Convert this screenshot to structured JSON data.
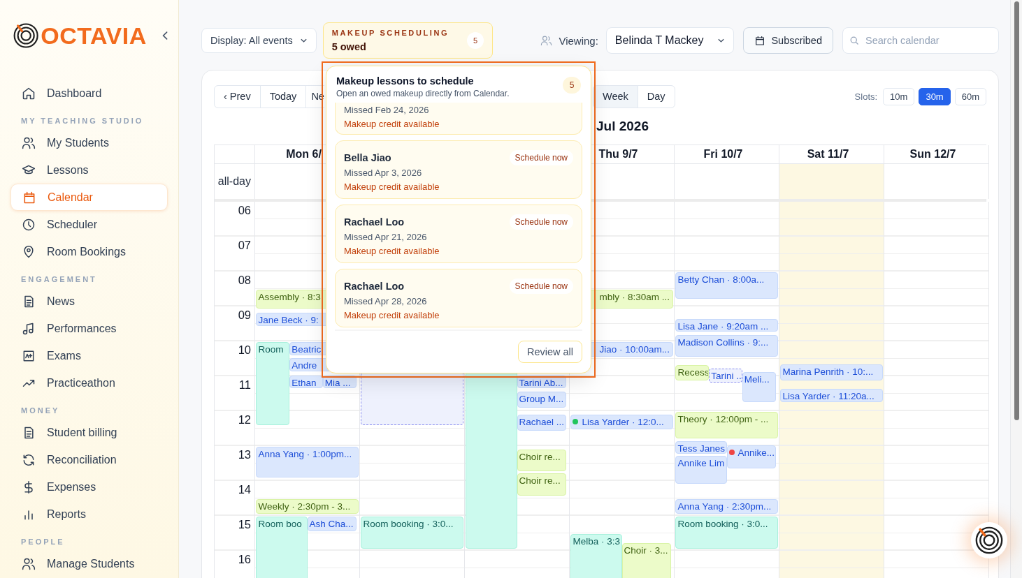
{
  "sidebar": {
    "brand": "OCTAVIA",
    "sections": [
      {
        "items": [
          {
            "label": "Dashboard",
            "selected": false
          }
        ]
      },
      {
        "heading": "MY TEACHING STUDIO",
        "items": [
          {
            "label": "My Students",
            "selected": false
          },
          {
            "label": "Lessons",
            "selected": false
          },
          {
            "label": "Calendar",
            "selected": true
          },
          {
            "label": "Scheduler",
            "selected": false
          },
          {
            "label": "Room Bookings",
            "selected": false
          }
        ]
      },
      {
        "heading": "ENGAGEMENT",
        "items": [
          {
            "label": "News",
            "selected": false
          },
          {
            "label": "Performances",
            "selected": false
          },
          {
            "label": "Exams",
            "selected": false
          },
          {
            "label": "Practiceathon",
            "selected": false
          }
        ]
      },
      {
        "heading": "MONEY",
        "items": [
          {
            "label": "Student billing",
            "selected": false
          },
          {
            "label": "Reconciliation",
            "selected": false
          },
          {
            "label": "Expenses",
            "selected": false
          },
          {
            "label": "Reports",
            "selected": false
          }
        ]
      },
      {
        "heading": "PEOPLE",
        "items": [
          {
            "label": "Manage Students",
            "selected": false
          }
        ]
      }
    ]
  },
  "toolbar": {
    "display_filter": "Display: All events",
    "makeup_summary": {
      "label": "MAKEUP SCHEDULING",
      "value": "5 owed",
      "count": "5"
    },
    "viewing_label": "Viewing:",
    "viewing_value": "Belinda T Mackey",
    "subscribe_button": "Subscribed",
    "search": {
      "placeholder": "Search calendar"
    }
  },
  "calendar": {
    "nav": [
      "‹ Prev",
      "Today",
      "Ne"
    ],
    "views": [
      {
        "label": "Week",
        "selected": true
      },
      {
        "label": "Day",
        "selected": false
      }
    ],
    "slots_label": "Slots:",
    "slots": [
      {
        "label": "10m",
        "selected": false
      },
      {
        "label": "30m",
        "selected": true
      },
      {
        "label": "60m",
        "selected": false
      }
    ],
    "title": "Jul 2026",
    "allday_label": "all-day",
    "hours": [
      "06",
      "07",
      "08",
      "09",
      "10",
      "11",
      "12",
      "13",
      "14",
      "15",
      "16"
    ],
    "days": [
      {
        "label": "Mon 6/",
        "highlighted": false,
        "events": [
          {
            "text": "Assembly · 8:3",
            "kind": "event"
          },
          {
            "text": "Jane Beck · 9:",
            "kind": "lesson"
          },
          {
            "text": "Room",
            "kind": "room"
          },
          {
            "text": "Beatric",
            "kind": "lesson"
          },
          {
            "text": "Andre",
            "kind": "lesson"
          },
          {
            "text": "Ethan",
            "kind": "lesson"
          },
          {
            "text": "Mia ...",
            "kind": "lesson"
          },
          {
            "text": "Anna Yang · 1:00pm...",
            "kind": "lesson"
          },
          {
            "text": "Weekly · 2:30pm - 3...",
            "kind": "event"
          },
          {
            "text": "Room boo",
            "kind": "room"
          },
          {
            "text": "Ash Cha...",
            "kind": "lesson"
          }
        ]
      },
      {
        "events": [
          {
            "kind": "pending"
          },
          {
            "text": "Room booking · 3:0...",
            "kind": "room"
          }
        ]
      },
      {
        "events": [
          {
            "kind": "room"
          },
          {
            "text": "Tarini Ab...",
            "kind": "lesson"
          },
          {
            "text": "Group M...",
            "kind": "lesson"
          },
          {
            "text": "Rachael ...",
            "kind": "lesson"
          },
          {
            "text": "Choir re...",
            "kind": "event"
          },
          {
            "text": "Choir re...",
            "kind": "event"
          }
        ]
      },
      {
        "label": "Thu 9/7",
        "highlighted": false,
        "events": [
          {
            "text": "mbly · 8:30am ...",
            "kind": "event"
          },
          {
            "text": "Jiao · 10:00am...",
            "kind": "lesson"
          },
          {
            "text": "Lisa Yarder · 12:0...",
            "kind": "lesson",
            "color": "#22c55e"
          },
          {
            "text": "Melba · 3:3",
            "kind": "room"
          },
          {
            "text": "Choir · 3...",
            "kind": "event"
          }
        ]
      },
      {
        "label": "Fri 10/7",
        "highlighted": false,
        "events": [
          {
            "text": "Betty Chan · 8:00a...",
            "kind": "lesson"
          },
          {
            "text": "Lisa Jane · 9:20am ...",
            "kind": "lesson"
          },
          {
            "text": "Madison Collins · 9:...",
            "kind": "lesson"
          },
          {
            "text": "Recess",
            "kind": "event"
          },
          {
            "text": "Tarini ..",
            "kind": "pending"
          },
          {
            "text": "Meli...",
            "kind": "lesson"
          },
          {
            "text": "Theory · 12:00pm - ...",
            "kind": "event"
          },
          {
            "text": "Tess Janes",
            "kind": "lesson"
          },
          {
            "text": "Annike Lim",
            "kind": "lesson"
          },
          {
            "text": "Annike...",
            "kind": "lesson",
            "color": "#ef4444"
          },
          {
            "text": "Anna Yang · 2:30pm...",
            "kind": "lesson"
          },
          {
            "text": "Room booking · 3:0...",
            "kind": "room"
          }
        ]
      },
      {
        "label": "Sat 11/7",
        "highlighted": true,
        "events": [
          {
            "text": "Marina Penrith · 10:...",
            "kind": "lesson"
          },
          {
            "text": "Lisa Yarder · 11:20a...",
            "kind": "lesson"
          }
        ]
      },
      {
        "label": "Sun 12/7",
        "highlighted": false
      }
    ]
  },
  "makeup_popup": {
    "title": "Makeup lessons to schedule",
    "subtitle": "Open an owed makeup directly from Calendar.",
    "count": "5",
    "items": [
      {
        "missed": "Missed Feb 24, 2026",
        "credit": "Makeup credit available"
      },
      {
        "name": "Bella Jiao",
        "action": "Schedule now",
        "missed": "Missed Apr 3, 2026",
        "credit": "Makeup credit available"
      },
      {
        "name": "Rachael Loo",
        "action": "Schedule now",
        "missed": "Missed Apr 21, 2026",
        "credit": "Makeup credit available"
      },
      {
        "name": "Rachael Loo",
        "action": "Schedule now",
        "missed": "Missed Apr 28, 2026",
        "credit": "Makeup credit available"
      }
    ],
    "footer_button": "Review all"
  }
}
